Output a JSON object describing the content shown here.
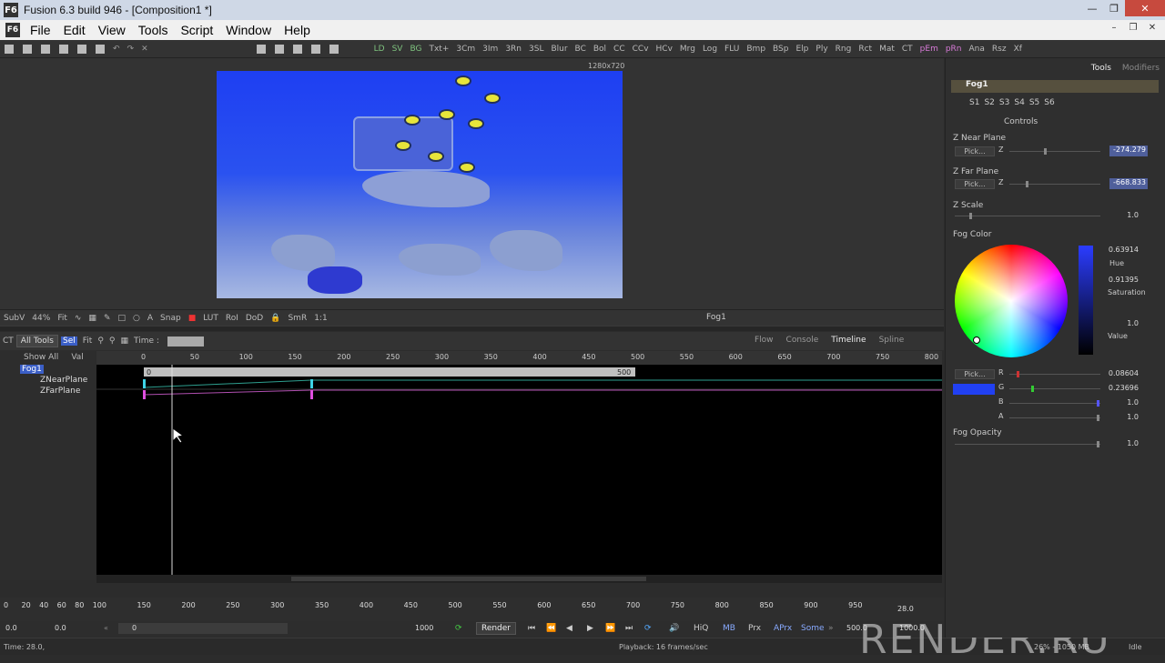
{
  "window": {
    "title": "Fusion 6.3 build 946 - [Composition1 *]",
    "app_icon": "F6"
  },
  "menu": [
    "File",
    "Edit",
    "View",
    "Tools",
    "Script",
    "Window",
    "Help"
  ],
  "toolbar": {
    "tools": [
      "LD",
      "SV",
      "BG",
      "Txt+",
      "3Cm",
      "3Im",
      "3Rn",
      "3SL",
      "Blur",
      "BC",
      "Bol",
      "CC",
      "CCv",
      "HCv",
      "Mrg",
      "Log",
      "FLU",
      "Bmp",
      "BSp",
      "Elp",
      "Ply",
      "Rng",
      "Rct",
      "Mat",
      "CT",
      "pEm",
      "pRn",
      "Ana",
      "Rsz",
      "Xf"
    ]
  },
  "viewer": {
    "resolution": "1280x720",
    "label": "Fog1"
  },
  "viewbar": {
    "subv": "SubV",
    "zoom": "44%",
    "fit": "Fit",
    "snap": "Snap",
    "lut": "LUT",
    "roi": "RoI",
    "dod": "DoD",
    "smr": "SmR",
    "ratio": "1:1"
  },
  "timeline_bar": {
    "ct": "CT",
    "all_tools": "All Tools",
    "sel": "Sel",
    "fit": "Fit",
    "time_label": "Time :",
    "show_all": "Show All",
    "val": "Val"
  },
  "panel_tabs": {
    "flow": "Flow",
    "console": "Console",
    "timeline": "Timeline",
    "spline": "Spline"
  },
  "tree": {
    "root": "Fog1",
    "items": [
      "ZNearPlane",
      "ZFarPlane"
    ]
  },
  "ruler_ticks": [
    "0",
    "50",
    "100",
    "150",
    "200",
    "250",
    "300",
    "350",
    "400",
    "450",
    "500",
    "550",
    "600",
    "650",
    "700",
    "750",
    "800"
  ],
  "range": {
    "start": "0",
    "end": "500"
  },
  "bottom_ruler": {
    "ticks": [
      "0",
      "20",
      "40",
      "60",
      "80",
      "100",
      "150",
      "200",
      "250",
      "300",
      "350",
      "400",
      "450",
      "500",
      "550",
      "600",
      "650",
      "700",
      "750",
      "800",
      "850",
      "900",
      "950"
    ],
    "current": "28.0"
  },
  "transport": {
    "start": "0.0",
    "render_start": "0.0",
    "global_start": "0",
    "render_end": "1000",
    "render_label": "Render",
    "hiq": "HiQ",
    "mb": "MB",
    "prx": "Prx",
    "aprx": "APrx",
    "some": "Some",
    "global_end": "500.0",
    "end": "1000.0"
  },
  "status": {
    "time": "Time: 28.0,",
    "playback": "Playback: 16 frames/sec",
    "memory": "26% - 1050 MB",
    "idle": "Idle"
  },
  "watermark": "RENDER.RU",
  "inspector": {
    "tabs": [
      "Tools",
      "Modifiers"
    ],
    "tool_name": "Fog1",
    "slots": [
      "S1",
      "S2",
      "S3",
      "S4",
      "S5",
      "S6"
    ],
    "controls_label": "Controls",
    "znear": {
      "label": "Z Near Plane",
      "pick": "Pick...",
      "axis": "Z",
      "value": "-274.279"
    },
    "zfar": {
      "label": "Z Far Plane",
      "pick": "Pick...",
      "axis": "Z",
      "value": "-668.833"
    },
    "zscale": {
      "label": "Z Scale",
      "value": "1.0"
    },
    "fog_color": {
      "label": "Fog Color",
      "hue": "0.63914",
      "hue_label": "Hue",
      "saturation": "0.91395",
      "saturation_label": "Saturation",
      "value": "1.0",
      "value_label": "Value",
      "pick": "Pick...",
      "r_label": "R",
      "r": "0.08604",
      "g_label": "G",
      "g": "0.23696",
      "b_label": "B",
      "b": "1.0",
      "a_label": "A",
      "a": "1.0",
      "swatch": "#2140f2"
    },
    "fog_opacity": {
      "label": "Fog Opacity",
      "value": "1.0"
    }
  }
}
